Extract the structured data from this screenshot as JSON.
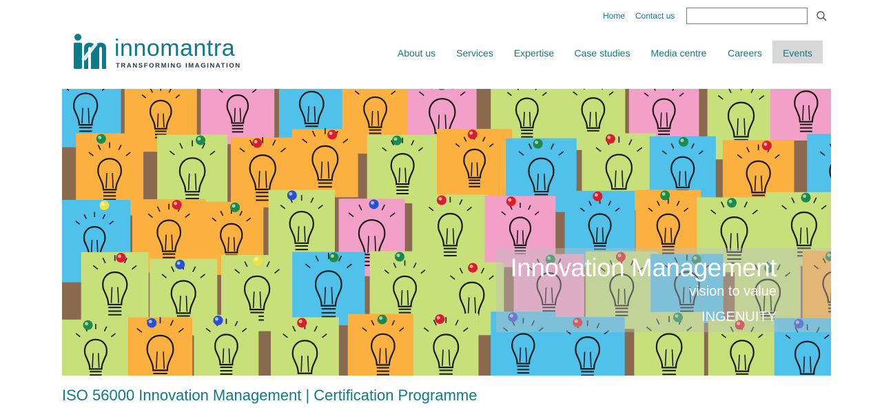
{
  "header": {
    "top_links": [
      {
        "label": "Home"
      },
      {
        "label": "Contact us"
      }
    ],
    "search": {
      "value": "",
      "placeholder": "",
      "icon": "search-icon"
    },
    "logo": {
      "wordmark": "innomantra",
      "tagline": "TRANSFORMING IMAGINATION",
      "mark": "IM"
    }
  },
  "nav": {
    "items": [
      {
        "label": "About us"
      },
      {
        "label": "Services"
      },
      {
        "label": "Expertise"
      },
      {
        "label": "Case studies"
      },
      {
        "label": "Media centre"
      },
      {
        "label": "Careers"
      },
      {
        "label": "Events",
        "active": true
      }
    ]
  },
  "hero": {
    "title": "Innovation Management",
    "subtitle": "vision to value",
    "tag": "INGENUITY",
    "image": "sticky-notes-lightbulbs"
  },
  "main": {
    "page_title": "ISO 56000 Innovation Management | Certification Programme"
  },
  "colors": {
    "brand_teal": "#0e7a8a",
    "active_nav_bg": "#d8d8d8",
    "note_green": "#c7e07a",
    "note_pink": "#f2a0c8",
    "note_blue": "#4fc1ea",
    "note_orange": "#fbb040",
    "corkboard": "#8a6a4e"
  }
}
